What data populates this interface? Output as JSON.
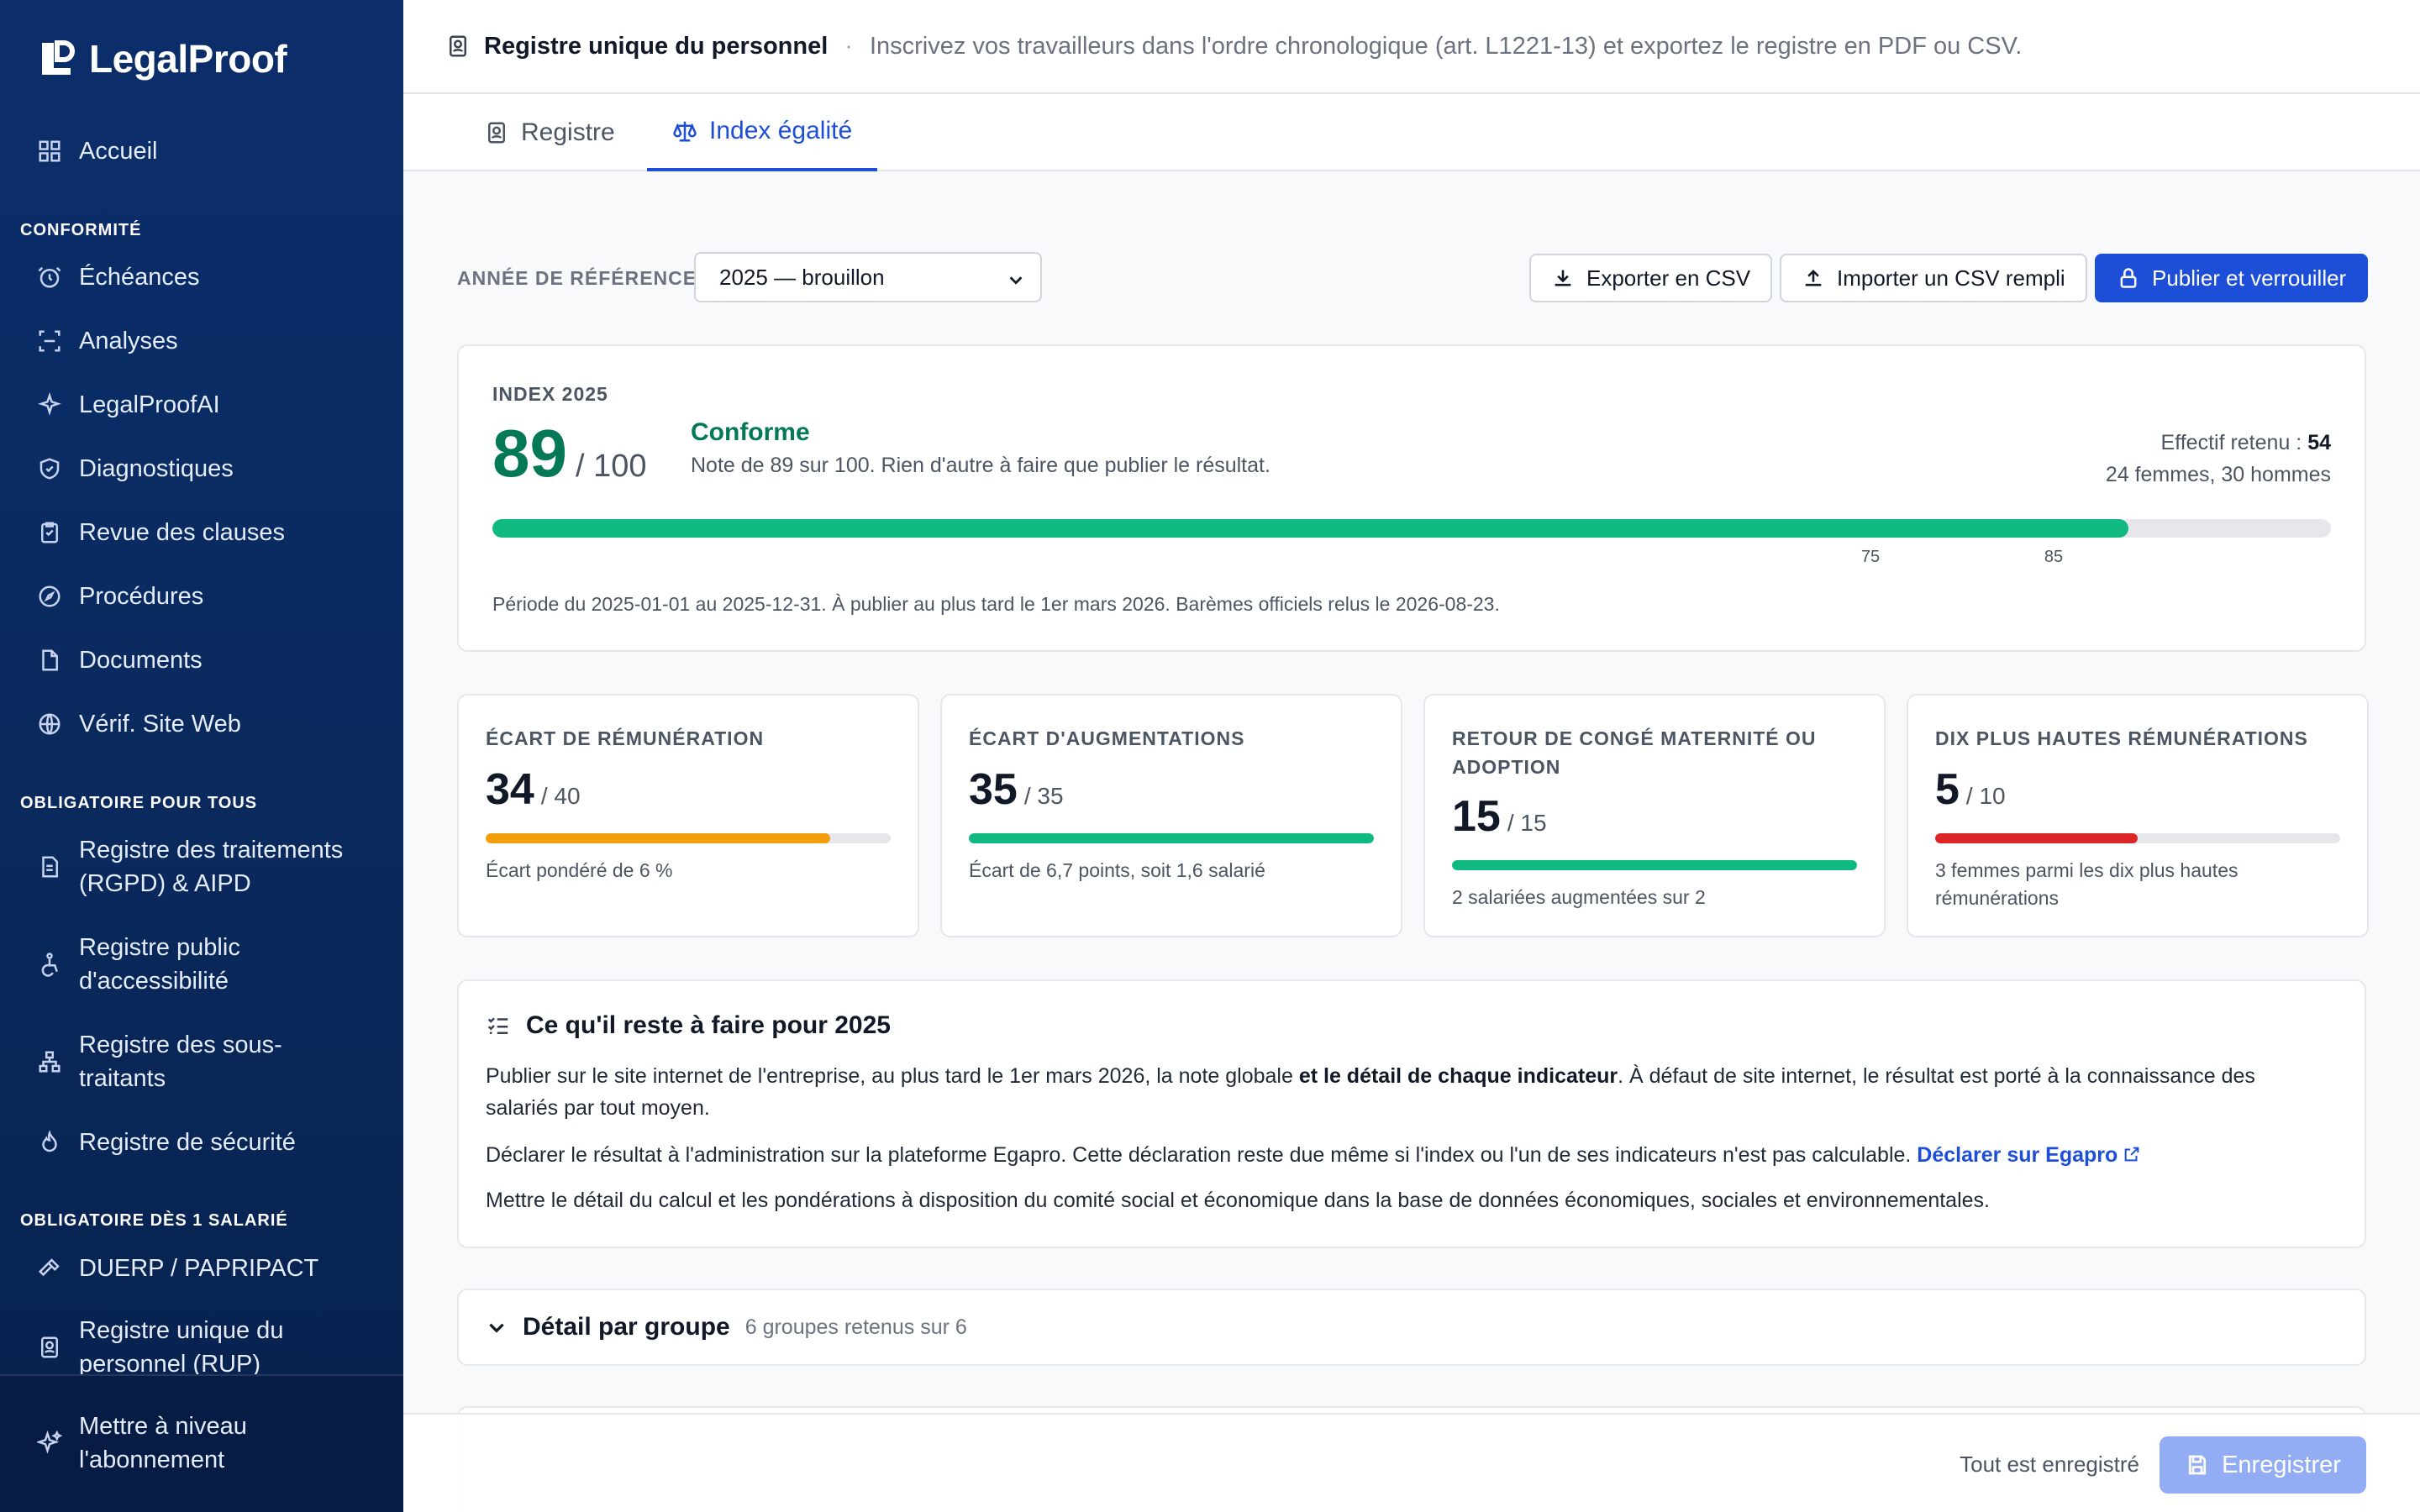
{
  "sidebar": {
    "brand": "LegalProof",
    "home": "Accueil",
    "sections": [
      {
        "title": "CONFORMITÉ"
      },
      {
        "title": "OBLIGATOIRE POUR TOUS"
      },
      {
        "title": "OBLIGATOIRE DÈS 1 SALARIÉ"
      }
    ],
    "conformite": [
      "Échéances",
      "Analyses",
      "LegalProofAI",
      "Diagnostiques",
      "Revue des clauses",
      "Procédures",
      "Documents",
      "Vérif. Site Web"
    ],
    "obligatoire_tous": [
      "Registre des traitements\n(RGPD) & AIPD",
      "Registre public\nd'accessibilité",
      "Registre des sous-\ntraitants",
      "Registre de sécurité"
    ],
    "obligatoire_salarie": [
      "DUERP / PAPRIPACT",
      "Registre unique du\npersonnel (RUP)"
    ],
    "upgrade": "Mettre à niveau\nl'abonnement"
  },
  "header": {
    "title": "Registre unique du personnel",
    "separator": "·",
    "description": "Inscrivez vos travailleurs dans l'ordre chronologique (art. L1221-13) et exportez le registre en PDF ou CSV."
  },
  "tabs": [
    {
      "label": "Registre"
    },
    {
      "label": "Index égalité"
    }
  ],
  "toolbar": {
    "year_label": "ANNÉE DE RÉFÉRENCE",
    "year_value": "2025 — brouillon",
    "export_csv": "Exporter en CSV",
    "import_csv": "Importer un CSV rempli",
    "publish": "Publier et verrouiller"
  },
  "index": {
    "label": "INDEX 2025",
    "score": "89",
    "max": "/ 100",
    "score_value": 89,
    "status": "Conforme",
    "note": "Note de 89 sur 100. Rien d'autre à faire que publier le résultat.",
    "effectif_label": "Effectif retenu : ",
    "effectif_value": "54",
    "breakdown": "24 femmes, 30 hommes",
    "thresholds": [
      "75",
      "85"
    ],
    "period": "Période du 2025-01-01 au 2025-12-31. À publier au plus tard le 1er mars 2026. Barèmes officiels relus le 2026-08-23.",
    "color": "#10b981"
  },
  "indicators": [
    {
      "title": "ÉCART DE RÉMUNÉRATION",
      "score": "34",
      "max": "/ 40",
      "value": 34,
      "total": 40,
      "note": "Écart pondéré de 6 %",
      "color": "#f59e0b"
    },
    {
      "title": "ÉCART D'AUGMENTATIONS",
      "score": "35",
      "max": "/ 35",
      "value": 35,
      "total": 35,
      "note": "Écart de 6,7 points, soit 1,6 salarié",
      "color": "#10b981"
    },
    {
      "title": "RETOUR DE CONGÉ MATERNITÉ OU ADOPTION",
      "score": "15",
      "max": "/ 15",
      "value": 15,
      "total": 15,
      "note": "2 salariées augmentées sur 2",
      "color": "#10b981"
    },
    {
      "title": "DIX PLUS HAUTES RÉMUNÉRATIONS",
      "score": "5",
      "max": "/ 10",
      "value": 5,
      "total": 10,
      "note": "3 femmes parmi les dix plus hautes rémunérations",
      "color": "#dc2626"
    }
  ],
  "todo": {
    "title": "Ce qu'il reste à faire pour 2025",
    "p1_start": "Publier sur le site internet de l'entreprise, au plus tard le 1er mars 2026, la note globale ",
    "p1_bold": "et le détail de chaque indicateur",
    "p1_end": ". À défaut de site internet, le résultat est porté à la connaissance des salariés par tout moyen.",
    "p2": "Déclarer le résultat à l'administration sur la plateforme Egapro. Cette déclaration reste due même si l'index ou l'un de ses indicateurs n'est pas calculable. ",
    "p2_link": "Déclarer sur Egapro",
    "p3": "Mettre le détail du calcul et les pondérations à disposition du comité social et économique dans la base de données économiques, sociales et environnementales."
  },
  "groups": {
    "title": "Détail par groupe",
    "subtitle": "6 groupes retenus sur 6"
  },
  "footer": {
    "status": "Tout est enregistré",
    "save": "Enregistrer"
  }
}
